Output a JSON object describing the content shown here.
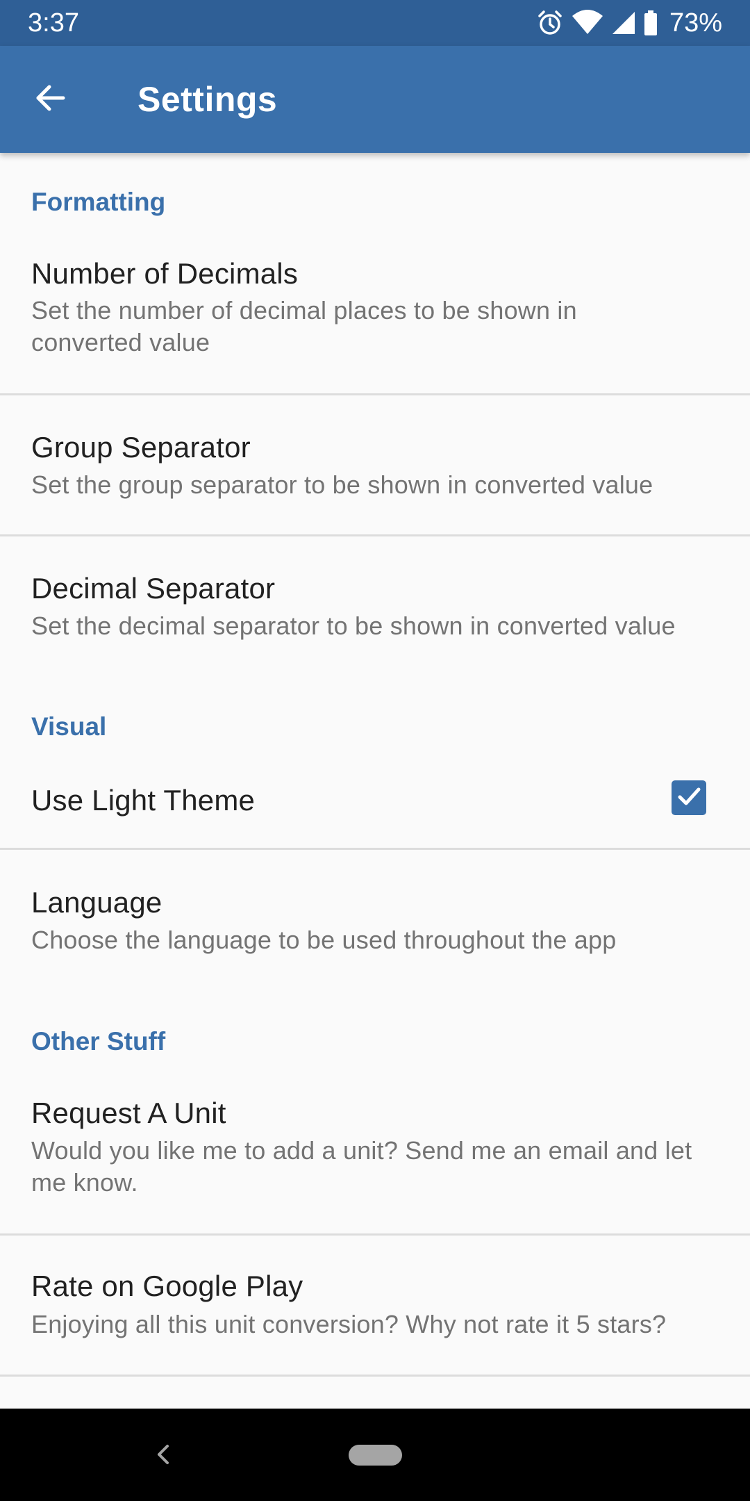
{
  "status_bar": {
    "time": "3:37",
    "battery_percent": "73%",
    "icons": [
      "alarm-icon",
      "wifi-icon",
      "signal-icon",
      "battery-icon"
    ]
  },
  "app_bar": {
    "title": "Settings",
    "back_icon": "arrow-left-icon"
  },
  "sections": {
    "formatting": {
      "header": "Formatting",
      "number_of_decimals": {
        "title": "Number of Decimals",
        "summary": "Set the number of decimal places to be shown in converted value"
      },
      "group_separator": {
        "title": "Group Separator",
        "summary": "Set the group separator to be shown in converted value"
      },
      "decimal_separator": {
        "title": "Decimal Separator",
        "summary": "Set the decimal separator to be shown in converted value"
      }
    },
    "visual": {
      "header": "Visual",
      "use_light_theme": {
        "title": "Use Light Theme",
        "checked": true
      },
      "language": {
        "title": "Language",
        "summary": "Choose the language to be used throughout the app"
      }
    },
    "other_stuff": {
      "header": "Other Stuff",
      "request_unit": {
        "title": "Request A Unit",
        "summary": "Would you like me to add a unit? Send me an email and let me know."
      },
      "rate": {
        "title": "Rate on Google Play",
        "summary": "Enjoying all this unit conversion? Why not rate it 5 stars?"
      }
    }
  },
  "colors": {
    "status_bar": "#2f5f96",
    "app_bar": "#3a70ab",
    "accent": "#3a70ab",
    "background": "#fafafa",
    "title_text": "#212121",
    "summary_text": "#737373",
    "divider": "#dcdcdc"
  }
}
